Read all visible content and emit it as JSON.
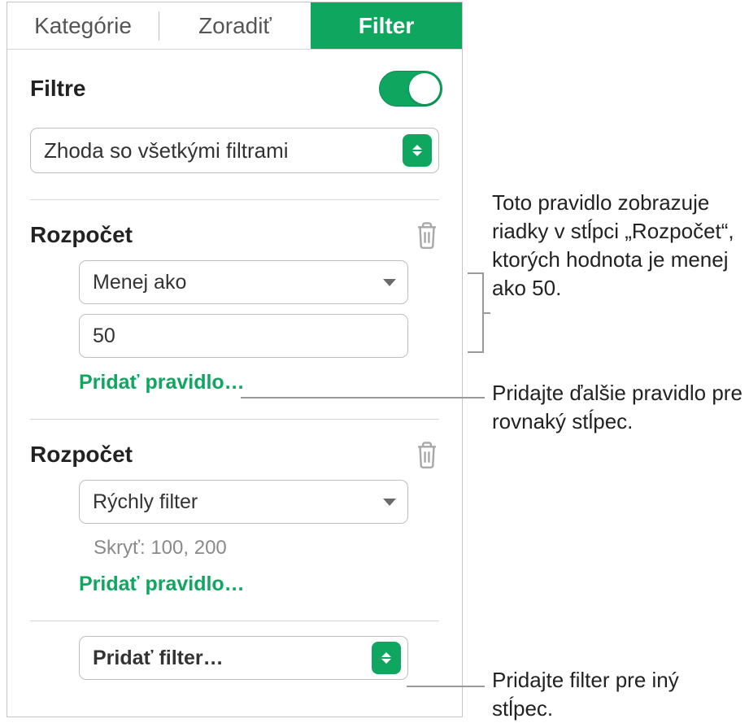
{
  "tabs": {
    "categories": "Kategórie",
    "sort": "Zoradiť",
    "filter": "Filter"
  },
  "header": {
    "title": "Filtre"
  },
  "match": {
    "label": "Zhoda so všetkými filtrami"
  },
  "groups": [
    {
      "column": "Rozpočet",
      "rule_type": "Menej ako",
      "value": "50",
      "add_rule": "Pridať pravidlo…"
    },
    {
      "column": "Rozpočet",
      "rule_type": "Rýchly filter",
      "hide_text": "Skryť: 100, 200",
      "add_rule": "Pridať pravidlo…"
    }
  ],
  "add_filter": {
    "label": "Pridať filter…"
  },
  "annotations": {
    "a1": "Toto pravidlo zobrazuje riadky v stĺpci „Rozpočet“, ktorých hodnota je menej ako 50.",
    "a2": "Pridajte ďalšie pravidlo pre rovnaký stĺpec.",
    "a3": "Pridajte filter pre iný stĺpec."
  }
}
